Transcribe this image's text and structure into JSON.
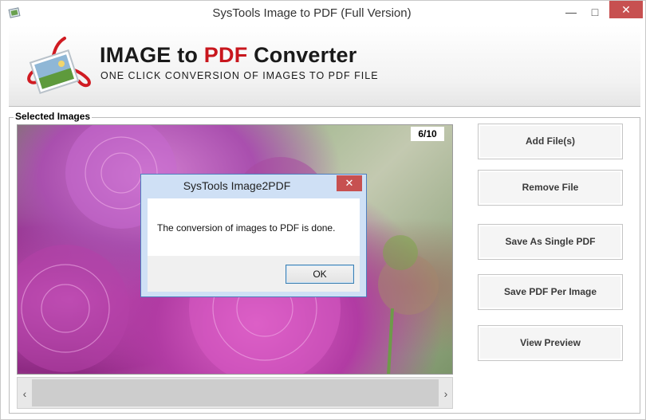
{
  "window": {
    "title": "SysTools Image to PDF (Full Version)",
    "minimize_glyph": "—",
    "maximize_glyph": "□",
    "close_glyph": "✕"
  },
  "banner": {
    "title_part1": "IMAGE to ",
    "title_part2": "PDF",
    "title_part3": " Converter",
    "subtitle": "ONE CLICK CONVERSION OF IMAGES TO PDF FILE"
  },
  "images": {
    "group_label": "Selected Images",
    "counter": "6/10",
    "scroll_left_glyph": "‹",
    "scroll_right_glyph": "›"
  },
  "actions": {
    "add_files": "Add File(s)",
    "remove_file": "Remove File",
    "save_single": "Save As Single PDF",
    "save_per_image": "Save PDF Per Image",
    "view_preview": "View Preview"
  },
  "dialog": {
    "title": "SysTools Image2PDF",
    "close_glyph": "✕",
    "message": "The conversion of images to PDF is done.",
    "ok_label": "OK"
  },
  "colors": {
    "brand_red": "#c8161d",
    "close_button": "#c75050",
    "dialog_border": "#4f7fbf"
  }
}
